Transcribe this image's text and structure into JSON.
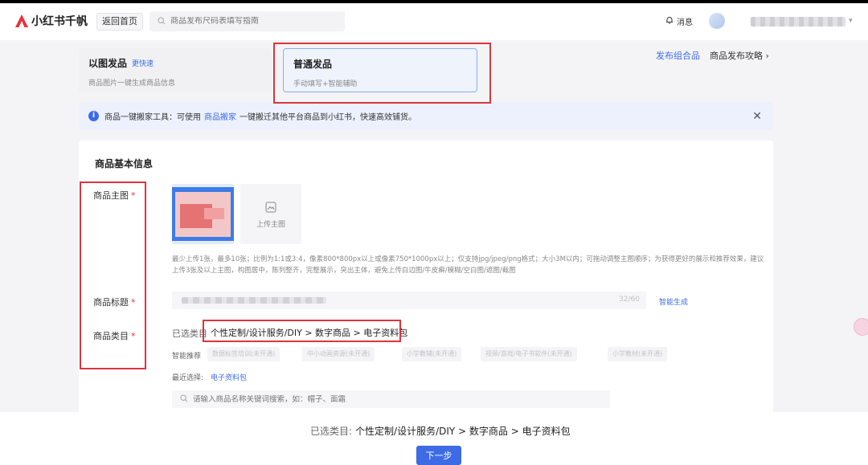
{
  "header": {
    "brand": "小红书千帆",
    "back_home": "返回首页",
    "search_placeholder": "商品发布尺码表填写指南",
    "messages": "消息"
  },
  "modes": {
    "image": {
      "title": "以图发品",
      "tag": "更快速",
      "subtitle": "商品图片一键生成商品信息"
    },
    "normal": {
      "title": "普通发品",
      "subtitle": "手动填写+智能辅助"
    }
  },
  "top_links": {
    "combo": "发布组合品",
    "guide": "商品发布攻略"
  },
  "notice": {
    "prefix": "商品一键搬家工具：可使用",
    "link": "商品搬家",
    "suffix": "一键搬迁其他平台商品到小红书，快速高效铺货。"
  },
  "form": {
    "section_title": "商品基本信息",
    "main_image_label": "商品主图",
    "title_label": "商品标题",
    "category_label": "商品类目",
    "required_mark": "*",
    "upload_text": "上传主图",
    "upload_hint": "最少上传1张，最多10张；比例为1:1或3:4，像素800*800px以上或像素750*1000px以上；仅支持jpg/jpeg/png格式；大小3M以内；可拖动调整主图顺序；为获得更好的展示和推荐效果，建议上传3张及以上主图，构图居中，陈列整齐，完整展示，突出主体，避免上传白边图/牛皮癣/模糊/空白图/遮图/截图",
    "title_count": "32/60",
    "smart_generate": "智能生成",
    "chosen_label": "已选类目",
    "chosen_path": "个性定制/设计服务/DIY > 数字商品 > 电子资料包",
    "recommend_label": "智能推荐",
    "recommend_chips": [
      "数据标签培训(未开通)",
      "中小动画资源(未开通)",
      "小学教辅(未开通)",
      "视频/游戏/电子书软件(未开通)",
      "小学教材(未开通)"
    ],
    "recent_label": "最近选择:",
    "recent_link": "电子资料包",
    "category_search_placeholder": "请输入商品名称关键词搜索，如：帽子、面霜"
  },
  "footer": {
    "chosen_label": "已选类目:",
    "chosen_path": "个性定制/设计服务/DIY > 数字商品 > 电子资料包",
    "next_button": "下一步"
  },
  "colors": {
    "accent": "#3d6be6",
    "highlight_box": "#d9363e",
    "brand": "#e8333b"
  }
}
